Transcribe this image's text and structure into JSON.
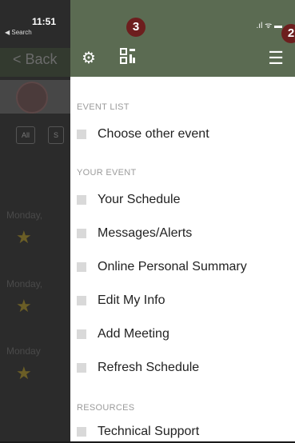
{
  "background": {
    "status_time": "11:51",
    "status_search": "◀ Search",
    "back_label": "Back",
    "days": [
      "Monday,",
      "Monday,",
      "Monday"
    ]
  },
  "drawer": {
    "badges": [
      "3",
      "2"
    ],
    "status_icons": ".ıl ᯤ ▬",
    "icons": {
      "settings": "gear-icon",
      "qr": "qr-code-icon",
      "menu": "hamburger-menu-icon"
    },
    "sections": [
      {
        "title": "EVENT LIST",
        "items": [
          "Choose other event"
        ]
      },
      {
        "title": "YOUR EVENT",
        "items": [
          "Your Schedule",
          "Messages/Alerts",
          "Online Personal Summary",
          "Edit My Info",
          "Add Meeting",
          "Refresh Schedule"
        ]
      },
      {
        "title": "RESOURCES",
        "items": [
          "Technical Support"
        ]
      }
    ]
  },
  "colors": {
    "topbar": "#5b6b52",
    "badge": "#6d1e1e",
    "drawer_bg": "#ffffff"
  }
}
